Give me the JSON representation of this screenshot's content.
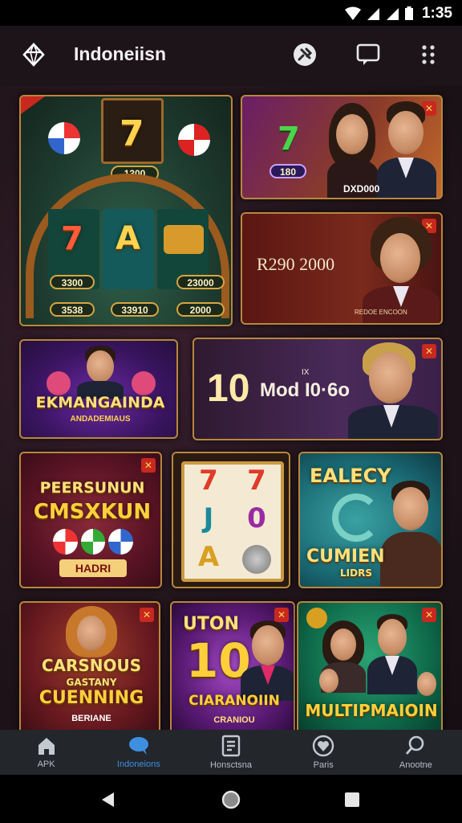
{
  "status": {
    "time": "1:35"
  },
  "header": {
    "title": "Indoneiisn"
  },
  "cards": {
    "c1": {
      "top_value": "1300",
      "val1": "3300",
      "val2": "23000",
      "val3": "3538",
      "val4": "33910",
      "val5": "2000",
      "reel1": "7",
      "reel2": "7",
      "reel3": "A"
    },
    "c2": {
      "value": "180",
      "caption": "DXD000",
      "reel": "7"
    },
    "c3": {
      "text": "R290 2000",
      "caption": "REDOE ENCOON"
    },
    "c4": {
      "title": "EKMANGAINDA",
      "subtitle": "ANDADEMIAUS"
    },
    "c5": {
      "big": "10",
      "text": "Mod I0·6o",
      "small": "IX"
    },
    "c6": {
      "line1": "PEERSUNUN",
      "line2": "CMSXKUN",
      "label": "HADRI"
    },
    "c7": {
      "r1": "7",
      "r2": "7",
      "r3": "J",
      "r4": "0",
      "r5": "A"
    },
    "c8": {
      "line1": "EALECY",
      "line2": "CUMIEN",
      "line3": "LIDRS"
    },
    "c9": {
      "line1": "CARSNOUS",
      "line2": "GASTANY",
      "line3": "CUENNING",
      "line4": "BERIANE"
    },
    "c10": {
      "line1": "UTON",
      "line2": "CIARANOIIN",
      "line3": "CRANIOU",
      "big": "10"
    },
    "c11": {
      "line1": "MULTIPMAIOIN"
    }
  },
  "nav": {
    "items": [
      {
        "label": "APK"
      },
      {
        "label": "Indoneions"
      },
      {
        "label": "Honsctsna"
      },
      {
        "label": "Paris"
      },
      {
        "label": "Anootne"
      }
    ]
  },
  "colors": {
    "accent": "#3e8fe0",
    "gold": "#ffd34d",
    "frame": "#b8873c"
  }
}
